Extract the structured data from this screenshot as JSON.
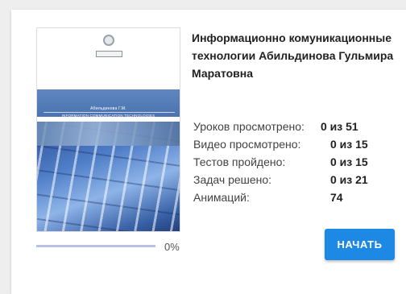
{
  "course": {
    "title": "Информационно комуникационные технологии Абильдинова Гульмира Маратовна",
    "cover": {
      "author": "Абильдинова Г.М.",
      "title": "INFORMATION COMMUNICATION TECHNOLOGIES",
      "emblem": "university-emblem-icon",
      "logo_text": "ЗКГТК"
    },
    "progress": {
      "value": 0,
      "label": "0%"
    },
    "stats": [
      {
        "label": "Уроков просмотрено:",
        "value": "0 из 51"
      },
      {
        "label": "Видео просмотрено:",
        "value": "0 из 15"
      },
      {
        "label": "Тестов пройдено:",
        "value": "0 из 15"
      },
      {
        "label": "Задач решено:",
        "value": "0 из 21"
      },
      {
        "label": "Анимаций:",
        "value": "74"
      }
    ],
    "start_button": "НАЧАТЬ"
  },
  "colors": {
    "accent": "#1e88e5",
    "progress_track": "#b9c0ea",
    "progress_fill": "#3f51b5"
  }
}
